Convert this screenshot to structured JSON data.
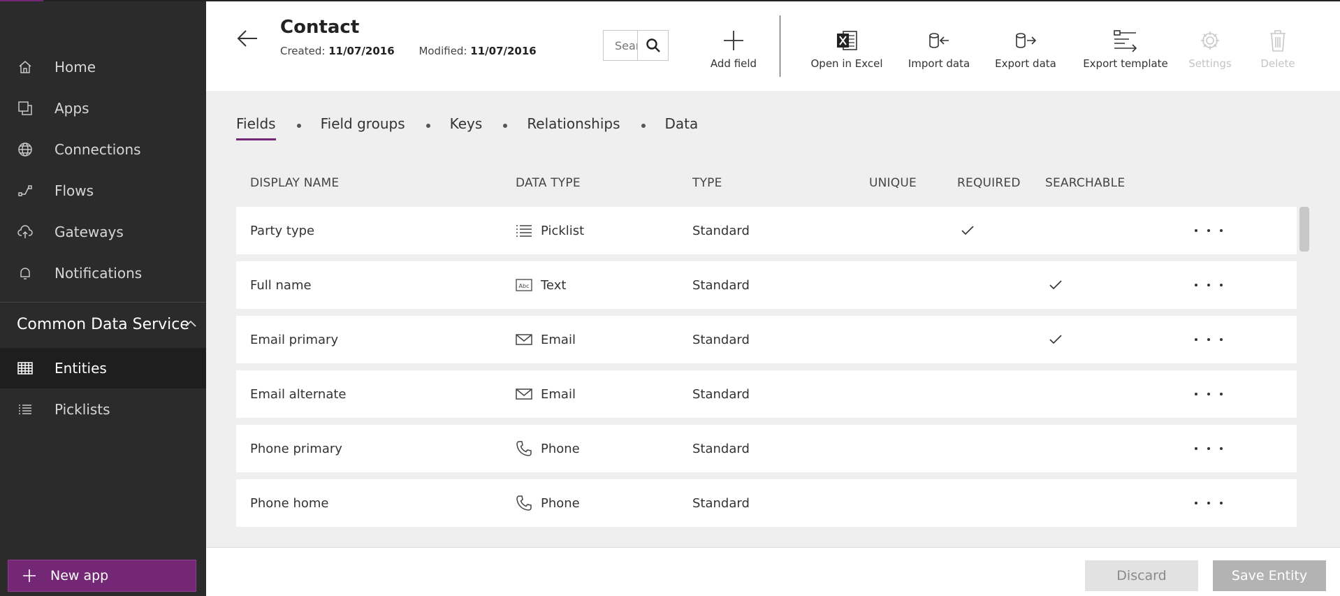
{
  "sidebar": {
    "items": [
      {
        "label": "Home",
        "icon": "home-icon"
      },
      {
        "label": "Apps",
        "icon": "apps-icon"
      },
      {
        "label": "Connections",
        "icon": "globe-icon"
      },
      {
        "label": "Flows",
        "icon": "flow-icon"
      },
      {
        "label": "Gateways",
        "icon": "cloud-upload-icon"
      },
      {
        "label": "Notifications",
        "icon": "bell-icon"
      }
    ],
    "section": {
      "label": "Common Data Service",
      "icon": "chevron-up-icon"
    },
    "sub_items": [
      {
        "label": "Entities",
        "icon": "table-icon",
        "active": true
      },
      {
        "label": "Picklists",
        "icon": "list-icon",
        "active": false
      }
    ],
    "new_app_label": "New app"
  },
  "header": {
    "title": "Contact",
    "created_label": "Created:",
    "created_value": "11/07/2016",
    "modified_label": "Modified:",
    "modified_value": "11/07/2016",
    "search_placeholder": "Search"
  },
  "toolbar": {
    "add_field": "Add field",
    "open_in_excel": "Open in Excel",
    "import_data": "Import data",
    "export_data": "Export data",
    "export_template": "Export template",
    "settings": "Settings",
    "delete": "Delete"
  },
  "tabs": [
    {
      "label": "Fields",
      "active": true
    },
    {
      "label": "Field groups",
      "active": false
    },
    {
      "label": "Keys",
      "active": false
    },
    {
      "label": "Relationships",
      "active": false
    },
    {
      "label": "Data",
      "active": false
    }
  ],
  "table": {
    "columns": {
      "display_name": "DISPLAY NAME",
      "data_type": "DATA TYPE",
      "type": "TYPE",
      "unique": "UNIQUE",
      "required": "REQUIRED",
      "searchable": "SEARCHABLE"
    },
    "rows": [
      {
        "display_name": "Party type",
        "data_type": "Picklist",
        "data_icon": "picklist-icon",
        "type": "Standard",
        "unique": false,
        "required": true,
        "searchable": false
      },
      {
        "display_name": "Full name",
        "data_type": "Text",
        "data_icon": "text-abc-icon",
        "type": "Standard",
        "unique": false,
        "required": false,
        "searchable": true
      },
      {
        "display_name": "Email primary",
        "data_type": "Email",
        "data_icon": "email-icon",
        "type": "Standard",
        "unique": false,
        "required": false,
        "searchable": true
      },
      {
        "display_name": "Email alternate",
        "data_type": "Email",
        "data_icon": "email-icon",
        "type": "Standard",
        "unique": false,
        "required": false,
        "searchable": false
      },
      {
        "display_name": "Phone primary",
        "data_type": "Phone",
        "data_icon": "phone-icon",
        "type": "Standard",
        "unique": false,
        "required": false,
        "searchable": false
      },
      {
        "display_name": "Phone home",
        "data_type": "Phone",
        "data_icon": "phone-icon",
        "type": "Standard",
        "unique": false,
        "required": false,
        "searchable": false
      }
    ]
  },
  "footer": {
    "discard": "Discard",
    "save": "Save Entity"
  },
  "colors": {
    "accent": "#742774",
    "sidebar_bg": "#2b2b2b",
    "content_bg": "#efefef"
  }
}
